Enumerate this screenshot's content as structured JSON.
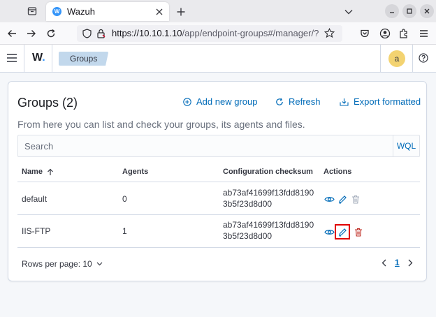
{
  "browser": {
    "tab_title": "Wazuh",
    "favicon_letter": "W",
    "url_host": "https://10.10.1.10",
    "url_path": "/app/endpoint-groups#/manager/?t"
  },
  "app": {
    "logo_text": "W",
    "logo_dot": ".",
    "breadcrumb": "Groups",
    "avatar_letter": "a"
  },
  "panel": {
    "title": "Groups (2)",
    "actions": {
      "add": "Add new group",
      "refresh": "Refresh",
      "export": "Export formatted"
    },
    "description": "From here you can list and check your groups, its agents and files.",
    "search_placeholder": "Search",
    "wql": "WQL",
    "columns": {
      "name": "Name",
      "agents": "Agents",
      "checksum": "Configuration checksum",
      "actions": "Actions"
    },
    "rows": [
      {
        "name": "default",
        "agents": "0",
        "checksum_1": "ab73af41699f13fdd8190",
        "checksum_2": "3b5f23d8d00"
      },
      {
        "name": "IIS-FTP",
        "agents": "1",
        "checksum_1": "ab73af41699f13fdd8190",
        "checksum_2": "3b5f23d8d00"
      }
    ],
    "rows_per_page": "Rows per page: 10",
    "current_page": "1"
  },
  "colors": {
    "accent": "#006bb8",
    "breadcrumb_bg": "#c2d8ec",
    "avatar_bg": "#f3d371",
    "delete_red": "#bd271e",
    "highlight": "#e00000"
  },
  "icons": [
    "tab-overview-icon",
    "wazuh-favicon-icon",
    "close-icon",
    "plus-icon",
    "chevron-down-icon",
    "minimize-icon",
    "maximize-icon",
    "close-window-icon",
    "back-icon",
    "forward-icon",
    "reload-icon",
    "shield-icon",
    "lock-icon",
    "star-icon",
    "pocket-icon",
    "account-icon",
    "extensions-icon",
    "menu-icon",
    "hamburger-icon",
    "help-icon",
    "plus-circle-icon",
    "refresh-icon",
    "export-icon",
    "sort-up-icon",
    "eye-icon",
    "pencil-icon",
    "trash-icon",
    "chevron-left-icon",
    "chevron-right-icon"
  ]
}
